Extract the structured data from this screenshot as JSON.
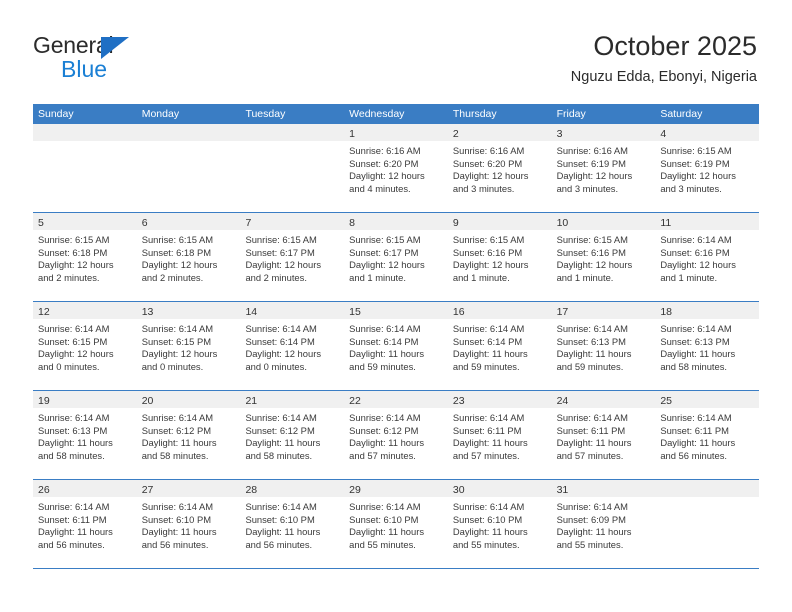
{
  "brand": {
    "name_top": "General",
    "name_bottom": "Blue",
    "accent_color": "#1a7fd4",
    "triangle_color": "#1f6fc4"
  },
  "header": {
    "title": "October 2025",
    "subtitle": "Nguzu Edda, Ebonyi, Nigeria"
  },
  "theme": {
    "header_row_bg": "#3a7dc4",
    "day_band_bg": "#f0f0f0",
    "row_rule": "#3a7dc4",
    "text": "#3a3a3a"
  },
  "weekdays": [
    "Sunday",
    "Monday",
    "Tuesday",
    "Wednesday",
    "Thursday",
    "Friday",
    "Saturday"
  ],
  "weeks": [
    [
      {
        "day": "",
        "sunrise": "",
        "sunset": "",
        "daylight1": "",
        "daylight2": ""
      },
      {
        "day": "",
        "sunrise": "",
        "sunset": "",
        "daylight1": "",
        "daylight2": ""
      },
      {
        "day": "",
        "sunrise": "",
        "sunset": "",
        "daylight1": "",
        "daylight2": ""
      },
      {
        "day": "1",
        "sunrise": "Sunrise: 6:16 AM",
        "sunset": "Sunset: 6:20 PM",
        "daylight1": "Daylight: 12 hours",
        "daylight2": "and 4 minutes."
      },
      {
        "day": "2",
        "sunrise": "Sunrise: 6:16 AM",
        "sunset": "Sunset: 6:20 PM",
        "daylight1": "Daylight: 12 hours",
        "daylight2": "and 3 minutes."
      },
      {
        "day": "3",
        "sunrise": "Sunrise: 6:16 AM",
        "sunset": "Sunset: 6:19 PM",
        "daylight1": "Daylight: 12 hours",
        "daylight2": "and 3 minutes."
      },
      {
        "day": "4",
        "sunrise": "Sunrise: 6:15 AM",
        "sunset": "Sunset: 6:19 PM",
        "daylight1": "Daylight: 12 hours",
        "daylight2": "and 3 minutes."
      }
    ],
    [
      {
        "day": "5",
        "sunrise": "Sunrise: 6:15 AM",
        "sunset": "Sunset: 6:18 PM",
        "daylight1": "Daylight: 12 hours",
        "daylight2": "and 2 minutes."
      },
      {
        "day": "6",
        "sunrise": "Sunrise: 6:15 AM",
        "sunset": "Sunset: 6:18 PM",
        "daylight1": "Daylight: 12 hours",
        "daylight2": "and 2 minutes."
      },
      {
        "day": "7",
        "sunrise": "Sunrise: 6:15 AM",
        "sunset": "Sunset: 6:17 PM",
        "daylight1": "Daylight: 12 hours",
        "daylight2": "and 2 minutes."
      },
      {
        "day": "8",
        "sunrise": "Sunrise: 6:15 AM",
        "sunset": "Sunset: 6:17 PM",
        "daylight1": "Daylight: 12 hours",
        "daylight2": "and 1 minute."
      },
      {
        "day": "9",
        "sunrise": "Sunrise: 6:15 AM",
        "sunset": "Sunset: 6:16 PM",
        "daylight1": "Daylight: 12 hours",
        "daylight2": "and 1 minute."
      },
      {
        "day": "10",
        "sunrise": "Sunrise: 6:15 AM",
        "sunset": "Sunset: 6:16 PM",
        "daylight1": "Daylight: 12 hours",
        "daylight2": "and 1 minute."
      },
      {
        "day": "11",
        "sunrise": "Sunrise: 6:14 AM",
        "sunset": "Sunset: 6:16 PM",
        "daylight1": "Daylight: 12 hours",
        "daylight2": "and 1 minute."
      }
    ],
    [
      {
        "day": "12",
        "sunrise": "Sunrise: 6:14 AM",
        "sunset": "Sunset: 6:15 PM",
        "daylight1": "Daylight: 12 hours",
        "daylight2": "and 0 minutes."
      },
      {
        "day": "13",
        "sunrise": "Sunrise: 6:14 AM",
        "sunset": "Sunset: 6:15 PM",
        "daylight1": "Daylight: 12 hours",
        "daylight2": "and 0 minutes."
      },
      {
        "day": "14",
        "sunrise": "Sunrise: 6:14 AM",
        "sunset": "Sunset: 6:14 PM",
        "daylight1": "Daylight: 12 hours",
        "daylight2": "and 0 minutes."
      },
      {
        "day": "15",
        "sunrise": "Sunrise: 6:14 AM",
        "sunset": "Sunset: 6:14 PM",
        "daylight1": "Daylight: 11 hours",
        "daylight2": "and 59 minutes."
      },
      {
        "day": "16",
        "sunrise": "Sunrise: 6:14 AM",
        "sunset": "Sunset: 6:14 PM",
        "daylight1": "Daylight: 11 hours",
        "daylight2": "and 59 minutes."
      },
      {
        "day": "17",
        "sunrise": "Sunrise: 6:14 AM",
        "sunset": "Sunset: 6:13 PM",
        "daylight1": "Daylight: 11 hours",
        "daylight2": "and 59 minutes."
      },
      {
        "day": "18",
        "sunrise": "Sunrise: 6:14 AM",
        "sunset": "Sunset: 6:13 PM",
        "daylight1": "Daylight: 11 hours",
        "daylight2": "and 58 minutes."
      }
    ],
    [
      {
        "day": "19",
        "sunrise": "Sunrise: 6:14 AM",
        "sunset": "Sunset: 6:13 PM",
        "daylight1": "Daylight: 11 hours",
        "daylight2": "and 58 minutes."
      },
      {
        "day": "20",
        "sunrise": "Sunrise: 6:14 AM",
        "sunset": "Sunset: 6:12 PM",
        "daylight1": "Daylight: 11 hours",
        "daylight2": "and 58 minutes."
      },
      {
        "day": "21",
        "sunrise": "Sunrise: 6:14 AM",
        "sunset": "Sunset: 6:12 PM",
        "daylight1": "Daylight: 11 hours",
        "daylight2": "and 58 minutes."
      },
      {
        "day": "22",
        "sunrise": "Sunrise: 6:14 AM",
        "sunset": "Sunset: 6:12 PM",
        "daylight1": "Daylight: 11 hours",
        "daylight2": "and 57 minutes."
      },
      {
        "day": "23",
        "sunrise": "Sunrise: 6:14 AM",
        "sunset": "Sunset: 6:11 PM",
        "daylight1": "Daylight: 11 hours",
        "daylight2": "and 57 minutes."
      },
      {
        "day": "24",
        "sunrise": "Sunrise: 6:14 AM",
        "sunset": "Sunset: 6:11 PM",
        "daylight1": "Daylight: 11 hours",
        "daylight2": "and 57 minutes."
      },
      {
        "day": "25",
        "sunrise": "Sunrise: 6:14 AM",
        "sunset": "Sunset: 6:11 PM",
        "daylight1": "Daylight: 11 hours",
        "daylight2": "and 56 minutes."
      }
    ],
    [
      {
        "day": "26",
        "sunrise": "Sunrise: 6:14 AM",
        "sunset": "Sunset: 6:11 PM",
        "daylight1": "Daylight: 11 hours",
        "daylight2": "and 56 minutes."
      },
      {
        "day": "27",
        "sunrise": "Sunrise: 6:14 AM",
        "sunset": "Sunset: 6:10 PM",
        "daylight1": "Daylight: 11 hours",
        "daylight2": "and 56 minutes."
      },
      {
        "day": "28",
        "sunrise": "Sunrise: 6:14 AM",
        "sunset": "Sunset: 6:10 PM",
        "daylight1": "Daylight: 11 hours",
        "daylight2": "and 56 minutes."
      },
      {
        "day": "29",
        "sunrise": "Sunrise: 6:14 AM",
        "sunset": "Sunset: 6:10 PM",
        "daylight1": "Daylight: 11 hours",
        "daylight2": "and 55 minutes."
      },
      {
        "day": "30",
        "sunrise": "Sunrise: 6:14 AM",
        "sunset": "Sunset: 6:10 PM",
        "daylight1": "Daylight: 11 hours",
        "daylight2": "and 55 minutes."
      },
      {
        "day": "31",
        "sunrise": "Sunrise: 6:14 AM",
        "sunset": "Sunset: 6:09 PM",
        "daylight1": "Daylight: 11 hours",
        "daylight2": "and 55 minutes."
      },
      {
        "day": "",
        "sunrise": "",
        "sunset": "",
        "daylight1": "",
        "daylight2": ""
      }
    ]
  ]
}
